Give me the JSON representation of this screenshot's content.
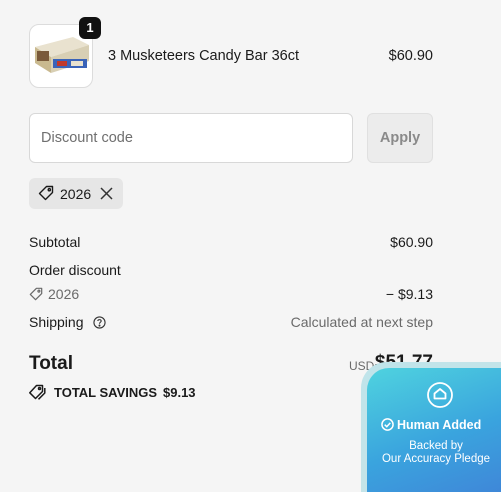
{
  "cart": {
    "item": {
      "quantity": "1",
      "name": "3 Musketeers Candy Bar 36ct",
      "price": "$60.90"
    }
  },
  "discount": {
    "placeholder": "Discount code",
    "apply_label": "Apply",
    "applied_code": "2026"
  },
  "summary": {
    "subtotal_label": "Subtotal",
    "subtotal_value": "$60.90",
    "order_discount_label": "Order discount",
    "order_discount_code": "2026",
    "order_discount_value": "− $9.13",
    "shipping_label": "Shipping",
    "shipping_value": "Calculated at next step",
    "total_label": "Total",
    "total_currency": "USD",
    "total_value": "$51.77",
    "savings_label": "TOTAL SAVINGS",
    "savings_value": "$9.13"
  },
  "pledge": {
    "title": "Human Added",
    "line1": "Backed by",
    "line2": "Our Accuracy Pledge"
  },
  "icons": [
    "tag-icon",
    "close-icon",
    "help-icon",
    "savings-tag-icon",
    "shield-icon",
    "check-circle-icon"
  ]
}
